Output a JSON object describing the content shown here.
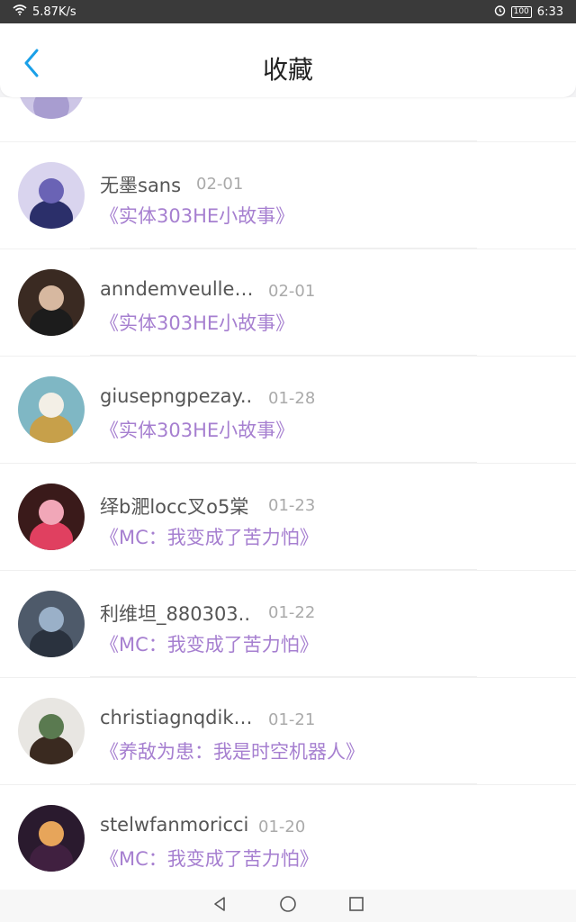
{
  "status_bar": {
    "speed": "5.87K/s",
    "battery": "100",
    "time": "6:33"
  },
  "header": {
    "title": "收藏"
  },
  "items": [
    {
      "name": "无墨sans",
      "date": "02-01",
      "link": "《实体303HE小故事》",
      "avatar_colors": [
        "#d9d4ee",
        "#6a63b5",
        "#2b2f6a"
      ]
    },
    {
      "name": "anndemveulle…",
      "date": "02-01",
      "link": "《实体303HE小故事》",
      "avatar_colors": [
        "#3a2a22",
        "#d7b8a0",
        "#1c1c1c"
      ]
    },
    {
      "name": "giusepngpezay..",
      "date": "01-28",
      "link": "《实体303HE小故事》",
      "avatar_colors": [
        "#7fb7c4",
        "#f3efe6",
        "#c7a04a"
      ]
    },
    {
      "name": "绎b淝locc叉o5棠",
      "date": "01-23",
      "link": "《MC：我变成了苦力怕》",
      "avatar_colors": [
        "#3a1a1a",
        "#f1a7b8",
        "#e04060"
      ]
    },
    {
      "name": "利维坦_880303..",
      "date": "01-22",
      "link": "《MC：我变成了苦力怕》",
      "avatar_colors": [
        "#4e5a6a",
        "#9ab0c8",
        "#2a323e"
      ]
    },
    {
      "name": "christiagnqdik…",
      "date": "01-21",
      "link": "《养敌为患：我是时空机器人》",
      "avatar_colors": [
        "#e8e6e2",
        "#5a7a50",
        "#3a2a20"
      ]
    },
    {
      "name": "stelwfanmoricci",
      "date": "01-20",
      "link": "《MC：我变成了苦力怕》",
      "avatar_colors": [
        "#2a1a2e",
        "#e7a55a",
        "#402040"
      ]
    }
  ]
}
